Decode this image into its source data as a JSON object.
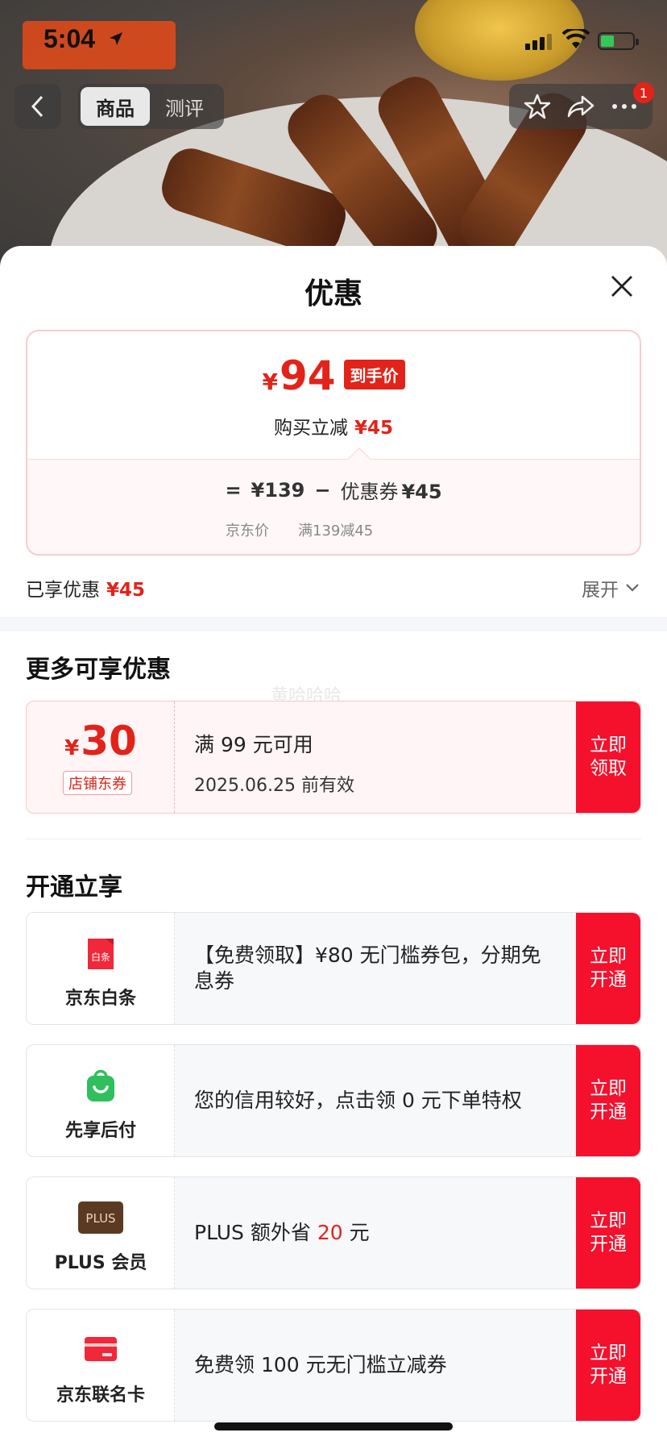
{
  "status_bar": {
    "time": "5:04"
  },
  "nav": {
    "tabs": [
      {
        "label": "商品",
        "active": true
      },
      {
        "label": "测评",
        "active": false
      }
    ],
    "message_badge": "1"
  },
  "sheet": {
    "title": "优惠",
    "final_price": {
      "symbol": "¥",
      "amount": "94",
      "tag": "到手价"
    },
    "reduction": {
      "label": "购买立减",
      "amount": "¥45"
    },
    "formula": {
      "equals": "=",
      "jd_price": "¥139",
      "minus": "−",
      "coupon_label": "优惠券",
      "coupon_amount": "¥45",
      "jd_price_label": "京东价",
      "coupon_rule": "满139减45"
    },
    "enjoyed": {
      "label": "已享优惠",
      "amount": "¥45"
    },
    "expand_label": "展开"
  },
  "more_offers": {
    "title": "更多可享优惠",
    "watermark": "黄哈哈哈",
    "coupon": {
      "symbol": "¥",
      "amount": "30",
      "type": "店铺东券",
      "condition": "满 99 元可用",
      "validity": "2025.06.25 前有效",
      "button": [
        "立即",
        "领取"
      ]
    }
  },
  "open_section": {
    "title": "开通立享",
    "items": [
      {
        "name": "京东白条",
        "icon": "baitiao-icon",
        "icon_text": "白条",
        "desc": "【免费领取】¥80 无门槛券包，分期免息券",
        "desc_red": "",
        "desc_tail": "",
        "button": [
          "立即",
          "开通"
        ]
      },
      {
        "name": "先享后付",
        "icon": "shopping-bag-icon",
        "icon_text": "",
        "desc": "您的信用较好，点击领 0 元下单特权",
        "desc_red": "",
        "desc_tail": "",
        "button": [
          "立即",
          "开通"
        ]
      },
      {
        "name": "PLUS 会员",
        "icon": "plus-icon",
        "icon_text": "PLUS",
        "desc": "PLUS 额外省 ",
        "desc_red": "20",
        "desc_tail": " 元",
        "button": [
          "立即",
          "开通"
        ]
      },
      {
        "name": "京东联名卡",
        "icon": "card-icon",
        "icon_text": "",
        "desc": "免费领 100 元无门槛立减券",
        "desc_red": "",
        "desc_tail": "",
        "button": [
          "立即",
          "开通"
        ]
      }
    ]
  },
  "colors": {
    "accent": "#e2231a",
    "button_red": "#f5102c",
    "green": "#2fbf5d",
    "plus_brown": "#5b3a24"
  }
}
